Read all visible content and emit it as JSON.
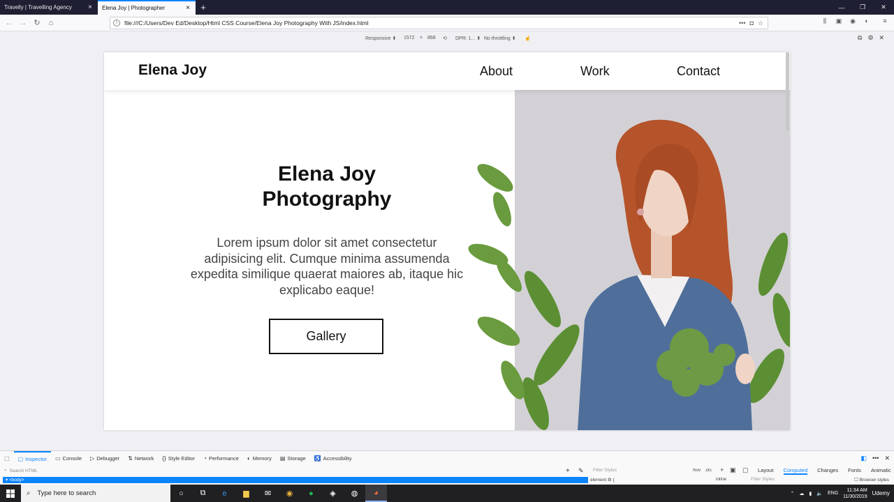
{
  "browser": {
    "tabs": [
      {
        "label": "Travelly | Travelling Agency",
        "active": false
      },
      {
        "label": "Elena Joy | Photographer",
        "active": true
      }
    ],
    "url": "file:///C:/Users/Dev Ed/Desktop/Html CSS Course/Elena Joy Photography With JS/index.html"
  },
  "responsive_bar": {
    "mode": "Responsive",
    "width": "1572",
    "times": "×",
    "height": "868",
    "dpr": "DPR: 1...",
    "throttling": "No throttling"
  },
  "site": {
    "logo": "Elena Joy",
    "nav": [
      "About",
      "Work",
      "Contact"
    ],
    "hero": {
      "title": "Elena Joy Photography",
      "text": "Lorem ipsum dolor sit amet consectetur adipisicing elit. Cumque minima assumenda expedita similique quaerat maiores ab, itaque hic explicabo eaque!",
      "button": "Gallery"
    }
  },
  "devtools": {
    "tabs": [
      "Inspector",
      "Console",
      "Debugger",
      "Network",
      "Style Editor",
      "Performance",
      "Memory",
      "Storage",
      "Accessibility"
    ],
    "search_placeholder": "Search HTML",
    "filter_styles": "Filter Styles",
    "hov": ":hov",
    "cls": ".cls",
    "selected_node": "<body>",
    "element_rule": "element",
    "element_brace": "{",
    "inline_label": "inline",
    "side_tabs": [
      "Layout",
      "Computed",
      "Changes",
      "Fonts",
      "Animatic"
    ],
    "browser_styles": "Browser styles"
  },
  "taskbar": {
    "search_placeholder": "Type here to search",
    "language": "ENG",
    "time": "11:34 AM",
    "date": "11/30/2019",
    "udemy": "Udemy"
  },
  "colors": {
    "accent": "#0a84ff",
    "tab_strip": "#1f1f33",
    "taskbar": "#202023",
    "photo_bg": "#cfcdd2",
    "hair": "#b5532a",
    "sweater": "#4f6f9a",
    "leaf": "#5c8f34"
  }
}
